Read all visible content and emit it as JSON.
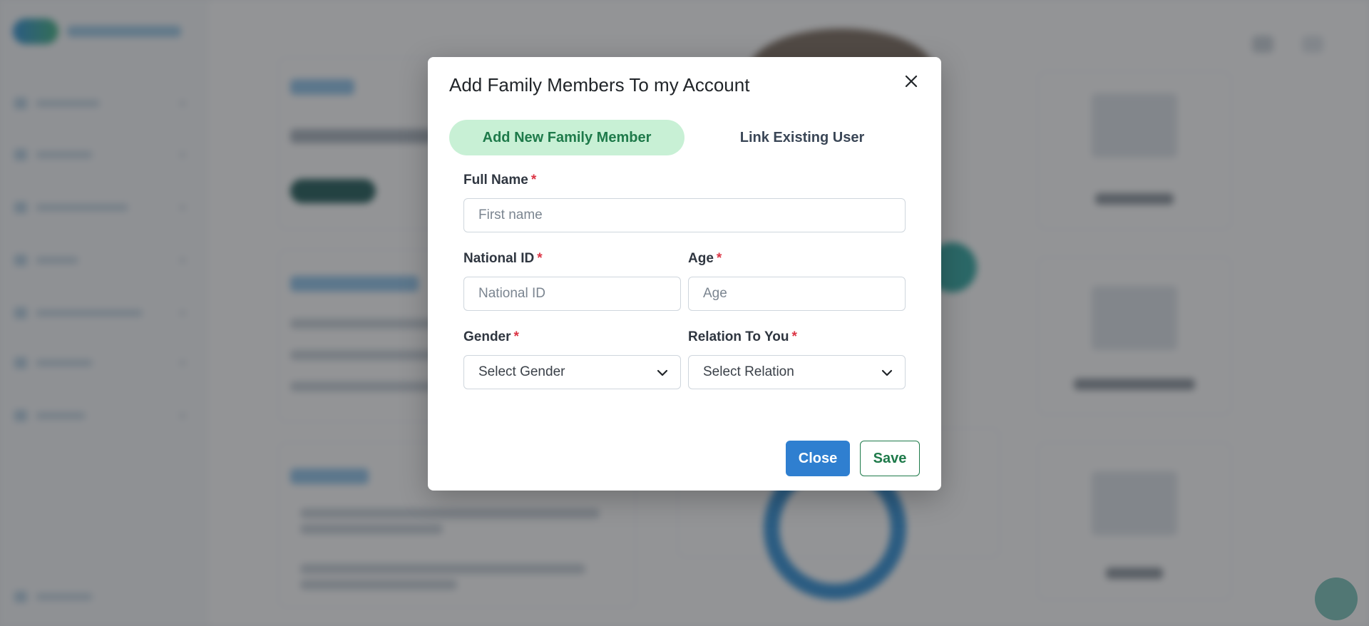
{
  "modal": {
    "title": "Add Family Members To my Account",
    "tabs": [
      {
        "label": "Add New Family Member",
        "active": true
      },
      {
        "label": "Link Existing User",
        "active": false
      }
    ],
    "required_marker": "*",
    "fields": {
      "full_name": {
        "label": "Full Name",
        "placeholder": "First name",
        "value": ""
      },
      "national_id": {
        "label": "National ID",
        "placeholder": "National ID",
        "value": ""
      },
      "age": {
        "label": "Age",
        "placeholder": "Age",
        "value": ""
      },
      "gender": {
        "label": "Gender",
        "selected": "Select Gender"
      },
      "relation": {
        "label": "Relation To You",
        "selected": "Select Relation"
      }
    },
    "buttons": {
      "close": "Close",
      "save": "Save"
    }
  },
  "colors": {
    "active_tab_bg": "#c8f0d5",
    "active_tab_text": "#1e7a4a",
    "primary": "#2f7fd0",
    "success": "#1e7a4a",
    "required": "#dc3545"
  },
  "icons": {
    "close": "close-icon",
    "select_caret": "chevron-down-icon"
  }
}
